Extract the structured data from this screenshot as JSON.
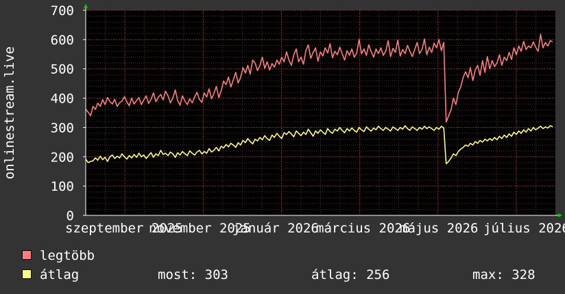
{
  "chart_data": {
    "type": "line",
    "ylabel": "onlinestream.live",
    "ylim": [
      0,
      700
    ],
    "yticks": [
      0,
      100,
      200,
      300,
      400,
      500,
      600,
      700
    ],
    "xticks": [
      "szeptember 2025",
      "november 2025",
      "január 2026",
      "március 2026",
      "május 2026",
      "július 2026"
    ],
    "grid": true,
    "colors": {
      "background": "#333333",
      "plot": "#000000",
      "grid": "#5a2a2a",
      "axis": "#ffffff",
      "arrow": "#00cc00"
    },
    "series": [
      {
        "name": "legtöbb",
        "color": "#ff7f7f",
        "values": [
          362,
          352,
          340,
          372,
          362,
          383,
          372,
          395,
          378,
          402,
          388,
          380,
          396,
          372,
          384,
          390,
          405,
          388,
          374,
          400,
          380,
          392,
          402,
          378,
          394,
          408,
          382,
          396,
          418,
          388,
          404,
          412,
          394,
          424,
          408,
          384,
          400,
          428,
          392,
          376,
          408,
          390,
          378,
          398,
          384,
          404,
          420,
          396,
          386,
          418,
          404,
          432,
          398,
          416,
          440,
          402,
          426,
          458,
          446,
          472,
          438,
          462,
          488,
          452,
          470,
          504,
          486,
          512,
          482,
          530,
          520,
          494,
          512,
          540,
          502,
          524,
          496,
          518,
          506,
          530,
          516,
          540,
          524,
          558,
          530,
          512,
          548,
          568,
          524,
          540,
          516,
          562,
          582,
          536,
          556,
          572,
          526,
          558,
          544,
          572,
          554,
          586,
          538,
          560,
          548,
          574,
          552,
          530,
          562,
          546,
          568,
          540,
          554,
          600,
          552,
          568,
          546,
          582,
          558,
          540,
          568,
          552,
          572,
          546,
          560,
          596,
          542,
          570,
          556,
          598,
          544,
          566,
          552,
          580,
          560,
          542,
          566,
          590,
          552,
          566,
          602,
          548,
          574,
          556,
          588,
          572,
          600,
          562,
          590,
          318,
          340,
          360,
          400,
          378,
          420,
          438,
          470,
          490,
          470,
          504,
          460,
          496,
          512,
          478,
          528,
          488,
          542,
          500,
          528,
          508,
          520,
          548,
          512,
          540,
          528,
          556,
          532,
          572,
          548,
          578,
          560,
          594,
          566,
          578,
          572,
          592,
          574,
          560,
          618,
          572,
          590,
          578,
          596,
          592
        ],
        "mean": null
      },
      {
        "name": "átlag",
        "color": "#ffff7f",
        "values": [
          192,
          180,
          184,
          186,
          196,
          188,
          202,
          190,
          198,
          184,
          200,
          206,
          194,
          202,
          196,
          210,
          200,
          192,
          204,
          196,
          208,
          198,
          212,
          200,
          206,
          194,
          204,
          214,
          198,
          210,
          204,
          222,
          208,
          212,
          204,
          216,
          210,
          198,
          214,
          206,
          218,
          210,
          204,
          220,
          212,
          206,
          216,
          222,
          210,
          218,
          212,
          228,
          216,
          222,
          232,
          220,
          236,
          230,
          242,
          234,
          246,
          240,
          232,
          248,
          240,
          256,
          248,
          262,
          252,
          244,
          260,
          254,
          266,
          258,
          272,
          262,
          256,
          274,
          266,
          280,
          270,
          262,
          282,
          276,
          286,
          278,
          268,
          288,
          280,
          272,
          284,
          276,
          294,
          282,
          270,
          288,
          280,
          292,
          284,
          276,
          296,
          286,
          280,
          294,
          288,
          300,
          290,
          282,
          296,
          288,
          298,
          290,
          284,
          300,
          292,
          286,
          302,
          294,
          288,
          298,
          292,
          304,
          296,
          290,
          300,
          294,
          288,
          302,
          296,
          290,
          300,
          294,
          306,
          296,
          290,
          302,
          296,
          290,
          300,
          294,
          304,
          296,
          302,
          296,
          290,
          300,
          294,
          304,
          298,
          176,
          184,
          196,
          210,
          204,
          218,
          226,
          232,
          240,
          236,
          246,
          240,
          252,
          246,
          256,
          250,
          260,
          254,
          262,
          256,
          266,
          258,
          270,
          262,
          274,
          266,
          278,
          270,
          284,
          276,
          288,
          280,
          292,
          284,
          296,
          288,
          300,
          292,
          298,
          304,
          296,
          302,
          298,
          306,
          303
        ],
        "stats": {
          "most": "most: 303",
          "atlag": "átlag: 256",
          "max": "max: 328"
        }
      }
    ]
  }
}
